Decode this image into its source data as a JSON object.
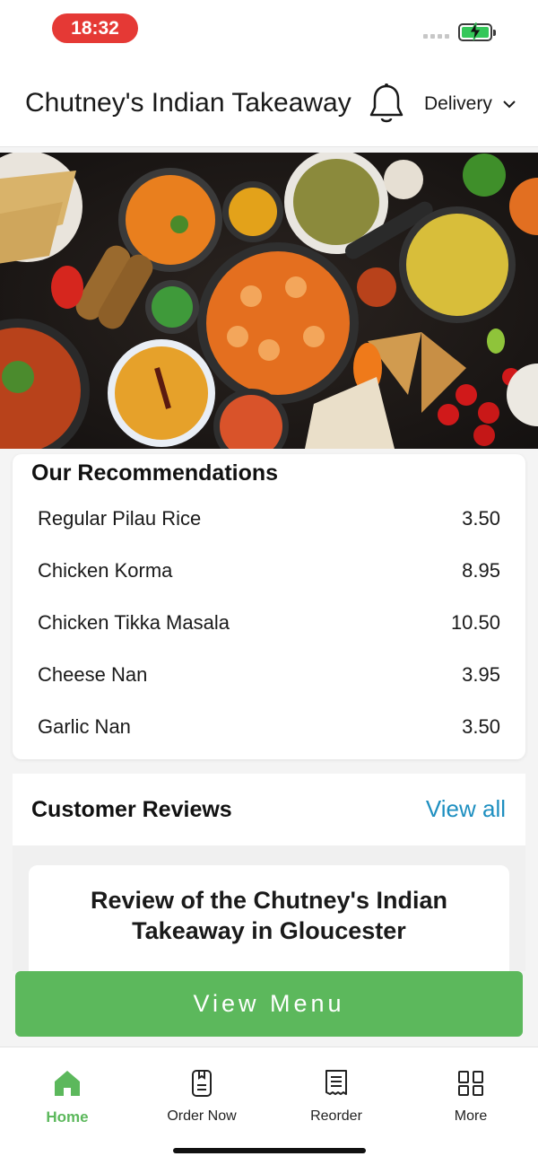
{
  "status_bar": {
    "time": "18:32"
  },
  "header": {
    "title": "Chutney's Indian Takeaway",
    "delivery_label": "Delivery"
  },
  "recommendations": {
    "title": "Our Recommendations",
    "items": [
      {
        "name": "Regular Pilau Rice",
        "price": "3.50"
      },
      {
        "name": "Chicken Korma",
        "price": "8.95"
      },
      {
        "name": "Chicken Tikka Masala",
        "price": "10.50"
      },
      {
        "name": "Cheese Nan",
        "price": "3.95"
      },
      {
        "name": "Garlic Nan",
        "price": "3.50"
      }
    ]
  },
  "reviews": {
    "title": "Customer Reviews",
    "view_all_label": "View all",
    "card_heading_line1": "Review of the Chutney's Indian",
    "card_heading_line2": "Takeaway in Gloucester"
  },
  "view_menu_label": "View Menu",
  "tab_bar": {
    "tabs": [
      {
        "label": "Home",
        "icon": "home-icon",
        "active": true
      },
      {
        "label": "Order Now",
        "icon": "order-icon",
        "active": false
      },
      {
        "label": "Reorder",
        "icon": "receipt-icon",
        "active": false
      },
      {
        "label": "More",
        "icon": "grid-icon",
        "active": false
      }
    ]
  },
  "colors": {
    "accent_green": "#5cb85c",
    "link_blue": "#1e8fc0",
    "time_pill_red": "#e53935"
  }
}
